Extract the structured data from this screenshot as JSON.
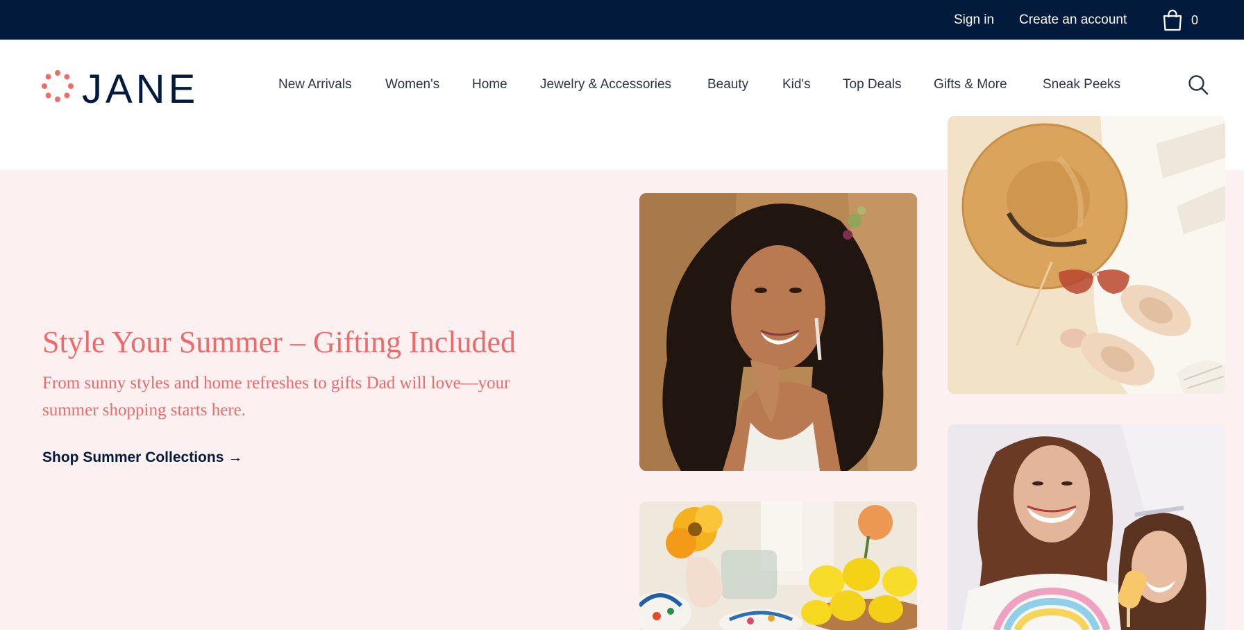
{
  "topbar": {
    "sign_in": "Sign in",
    "create_account": "Create an account",
    "bag_icon": "shopping-bag-icon",
    "bag_count": "0"
  },
  "brand": {
    "name": "JANE",
    "mark_icon": "dotted-circle-logo-icon"
  },
  "nav": {
    "items": [
      {
        "label": "New Arrivals"
      },
      {
        "label": "Women's"
      },
      {
        "label": "Home"
      },
      {
        "label": "Jewelry & Accessories"
      },
      {
        "label": "Beauty"
      },
      {
        "label": "Kid's"
      },
      {
        "label": "Top Deals"
      },
      {
        "label": "Gifts & More"
      },
      {
        "label": "Sneak Peeks"
      }
    ],
    "search_icon": "search-icon"
  },
  "hero": {
    "headline": "Style Your Summer – Gifting Included",
    "subcopy": "From sunny styles and home refreshes to gifts Dad will love—your summer shopping starts here.",
    "cta": "Shop Summer Collections →"
  },
  "colors": {
    "topbar_bg": "#021b3d",
    "hero_bg": "#fdf0f0",
    "accent_coral": "#ee6a6a",
    "navy": "#021b3d"
  },
  "images": [
    {
      "name": "smiling-woman-photo"
    },
    {
      "name": "straw-hat-sunglasses-sandals-photo"
    },
    {
      "name": "lemons-flowers-tableware-photo"
    },
    {
      "name": "two-women-laughing-photo"
    }
  ]
}
